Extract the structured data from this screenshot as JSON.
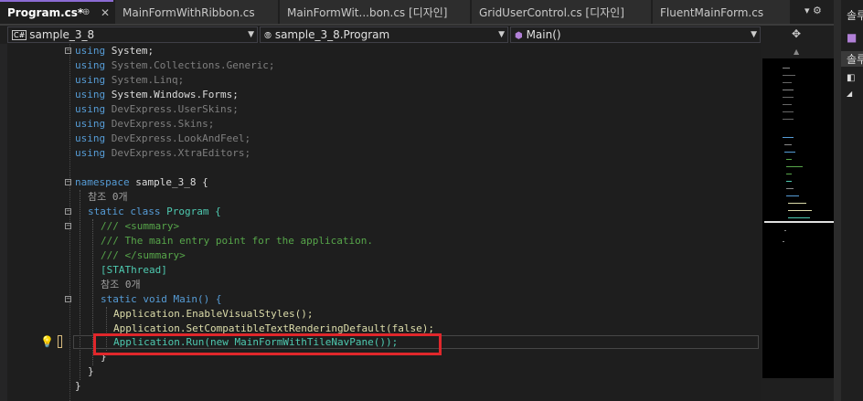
{
  "tabs": [
    {
      "label": "Program.cs*",
      "active": true
    },
    {
      "label": "MainFormWithRibbon.cs",
      "active": false
    },
    {
      "label": "MainFormWit...bon.cs [디자인]",
      "active": false
    },
    {
      "label": "GridUserControl.cs [디자인]",
      "active": false
    },
    {
      "label": "FluentMainForm.cs",
      "active": false
    }
  ],
  "tab_icons": {
    "pin": "⊕",
    "close": "✕",
    "overflow": "▾ ⚙"
  },
  "navigation": {
    "project": "sample_3_8",
    "project_badge": "C#",
    "type": "sample_3_8.Program",
    "member": "Main()"
  },
  "code_lines": [
    {
      "line": "using System;"
    },
    {
      "line": "using System.Collections.Generic;"
    },
    {
      "line": "using System.Linq;"
    },
    {
      "line": "using System.Windows.Forms;"
    },
    {
      "line": "using DevExpress.UserSkins;"
    },
    {
      "line": "using DevExpress.Skins;"
    },
    {
      "line": "using DevExpress.LookAndFeel;"
    },
    {
      "line": "using DevExpress.XtraEditors;"
    },
    {
      "line": ""
    },
    {
      "line": "namespace sample_3_8 {"
    },
    {
      "line": "참조 0개"
    },
    {
      "line": "static class Program {"
    },
    {
      "line": "/// <summary>"
    },
    {
      "line": "/// The main entry point for the application."
    },
    {
      "line": "/// </summary>"
    },
    {
      "line": "[STAThread]"
    },
    {
      "line": "참조 0개"
    },
    {
      "line": "static void Main() {"
    },
    {
      "line": "Application.EnableVisualStyles();"
    },
    {
      "line": "Application.SetCompatibleTextRenderingDefault(false);"
    },
    {
      "line": "Application.Run(new MainFormWithTileNavPane());"
    },
    {
      "line": "}"
    },
    {
      "line": "}"
    },
    {
      "line": "}"
    }
  ],
  "right_panel": {
    "title_top": "솔루",
    "title_mid": "솔루"
  },
  "colors": {
    "accent": "#8b6bd3",
    "highlight_box": "#e0272b",
    "keyword": "#569cd6",
    "type": "#4ec9b0",
    "comment": "#57a64a"
  }
}
